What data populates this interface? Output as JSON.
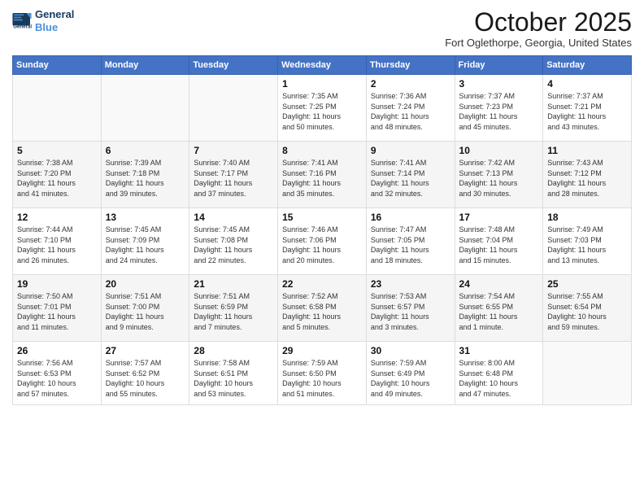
{
  "header": {
    "logo_line1": "General",
    "logo_line2": "Blue",
    "month": "October 2025",
    "location": "Fort Oglethorpe, Georgia, United States"
  },
  "weekdays": [
    "Sunday",
    "Monday",
    "Tuesday",
    "Wednesday",
    "Thursday",
    "Friday",
    "Saturday"
  ],
  "weeks": [
    [
      {
        "day": "",
        "info": ""
      },
      {
        "day": "",
        "info": ""
      },
      {
        "day": "",
        "info": ""
      },
      {
        "day": "1",
        "info": "Sunrise: 7:35 AM\nSunset: 7:25 PM\nDaylight: 11 hours\nand 50 minutes."
      },
      {
        "day": "2",
        "info": "Sunrise: 7:36 AM\nSunset: 7:24 PM\nDaylight: 11 hours\nand 48 minutes."
      },
      {
        "day": "3",
        "info": "Sunrise: 7:37 AM\nSunset: 7:23 PM\nDaylight: 11 hours\nand 45 minutes."
      },
      {
        "day": "4",
        "info": "Sunrise: 7:37 AM\nSunset: 7:21 PM\nDaylight: 11 hours\nand 43 minutes."
      }
    ],
    [
      {
        "day": "5",
        "info": "Sunrise: 7:38 AM\nSunset: 7:20 PM\nDaylight: 11 hours\nand 41 minutes."
      },
      {
        "day": "6",
        "info": "Sunrise: 7:39 AM\nSunset: 7:18 PM\nDaylight: 11 hours\nand 39 minutes."
      },
      {
        "day": "7",
        "info": "Sunrise: 7:40 AM\nSunset: 7:17 PM\nDaylight: 11 hours\nand 37 minutes."
      },
      {
        "day": "8",
        "info": "Sunrise: 7:41 AM\nSunset: 7:16 PM\nDaylight: 11 hours\nand 35 minutes."
      },
      {
        "day": "9",
        "info": "Sunrise: 7:41 AM\nSunset: 7:14 PM\nDaylight: 11 hours\nand 32 minutes."
      },
      {
        "day": "10",
        "info": "Sunrise: 7:42 AM\nSunset: 7:13 PM\nDaylight: 11 hours\nand 30 minutes."
      },
      {
        "day": "11",
        "info": "Sunrise: 7:43 AM\nSunset: 7:12 PM\nDaylight: 11 hours\nand 28 minutes."
      }
    ],
    [
      {
        "day": "12",
        "info": "Sunrise: 7:44 AM\nSunset: 7:10 PM\nDaylight: 11 hours\nand 26 minutes."
      },
      {
        "day": "13",
        "info": "Sunrise: 7:45 AM\nSunset: 7:09 PM\nDaylight: 11 hours\nand 24 minutes."
      },
      {
        "day": "14",
        "info": "Sunrise: 7:45 AM\nSunset: 7:08 PM\nDaylight: 11 hours\nand 22 minutes."
      },
      {
        "day": "15",
        "info": "Sunrise: 7:46 AM\nSunset: 7:06 PM\nDaylight: 11 hours\nand 20 minutes."
      },
      {
        "day": "16",
        "info": "Sunrise: 7:47 AM\nSunset: 7:05 PM\nDaylight: 11 hours\nand 18 minutes."
      },
      {
        "day": "17",
        "info": "Sunrise: 7:48 AM\nSunset: 7:04 PM\nDaylight: 11 hours\nand 15 minutes."
      },
      {
        "day": "18",
        "info": "Sunrise: 7:49 AM\nSunset: 7:03 PM\nDaylight: 11 hours\nand 13 minutes."
      }
    ],
    [
      {
        "day": "19",
        "info": "Sunrise: 7:50 AM\nSunset: 7:01 PM\nDaylight: 11 hours\nand 11 minutes."
      },
      {
        "day": "20",
        "info": "Sunrise: 7:51 AM\nSunset: 7:00 PM\nDaylight: 11 hours\nand 9 minutes."
      },
      {
        "day": "21",
        "info": "Sunrise: 7:51 AM\nSunset: 6:59 PM\nDaylight: 11 hours\nand 7 minutes."
      },
      {
        "day": "22",
        "info": "Sunrise: 7:52 AM\nSunset: 6:58 PM\nDaylight: 11 hours\nand 5 minutes."
      },
      {
        "day": "23",
        "info": "Sunrise: 7:53 AM\nSunset: 6:57 PM\nDaylight: 11 hours\nand 3 minutes."
      },
      {
        "day": "24",
        "info": "Sunrise: 7:54 AM\nSunset: 6:55 PM\nDaylight: 11 hours\nand 1 minute."
      },
      {
        "day": "25",
        "info": "Sunrise: 7:55 AM\nSunset: 6:54 PM\nDaylight: 10 hours\nand 59 minutes."
      }
    ],
    [
      {
        "day": "26",
        "info": "Sunrise: 7:56 AM\nSunset: 6:53 PM\nDaylight: 10 hours\nand 57 minutes."
      },
      {
        "day": "27",
        "info": "Sunrise: 7:57 AM\nSunset: 6:52 PM\nDaylight: 10 hours\nand 55 minutes."
      },
      {
        "day": "28",
        "info": "Sunrise: 7:58 AM\nSunset: 6:51 PM\nDaylight: 10 hours\nand 53 minutes."
      },
      {
        "day": "29",
        "info": "Sunrise: 7:59 AM\nSunset: 6:50 PM\nDaylight: 10 hours\nand 51 minutes."
      },
      {
        "day": "30",
        "info": "Sunrise: 7:59 AM\nSunset: 6:49 PM\nDaylight: 10 hours\nand 49 minutes."
      },
      {
        "day": "31",
        "info": "Sunrise: 8:00 AM\nSunset: 6:48 PM\nDaylight: 10 hours\nand 47 minutes."
      },
      {
        "day": "",
        "info": ""
      }
    ]
  ]
}
